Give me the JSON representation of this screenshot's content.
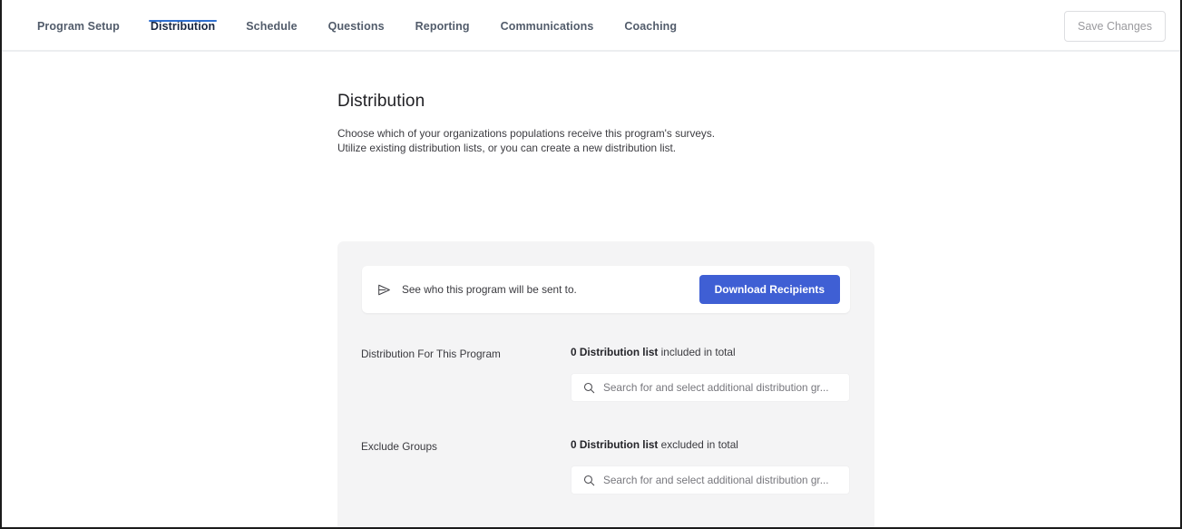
{
  "nav": {
    "tabs": [
      {
        "label": "Program Setup",
        "active": false
      },
      {
        "label": "Distribution",
        "active": true
      },
      {
        "label": "Schedule",
        "active": false
      },
      {
        "label": "Questions",
        "active": false
      },
      {
        "label": "Reporting",
        "active": false
      },
      {
        "label": "Communications",
        "active": false
      },
      {
        "label": "Coaching",
        "active": false
      }
    ],
    "save_label": "Save Changes"
  },
  "main": {
    "title": "Distribution",
    "description_line_1": "Choose which of your organizations populations receive this program's surveys.",
    "description_line_2": "Utilize existing distribution lists, or you can create a new distribution list."
  },
  "recipients_card": {
    "icon": "send-icon",
    "text": "See who this program will be sent to.",
    "button_label": "Download Recipients"
  },
  "distribution_row": {
    "label": "Distribution For This Program",
    "count_strong": "0 Distribution list",
    "count_rest": " included in total",
    "search_placeholder": "Search for and select additional distribution gr...",
    "search_value": "",
    "search_icon": "search-icon"
  },
  "exclude_row": {
    "label": "Exclude Groups",
    "count_strong": "0 Distribution list",
    "count_rest": " excluded in total",
    "search_placeholder": "Search for and select additional distribution gr...",
    "search_value": "",
    "search_icon": "search-icon"
  },
  "colors": {
    "accent_blue": "#3f5fd4",
    "tab_underline": "#2f6fd0",
    "panel_grey": "#f4f4f5",
    "active_tab_text": "#1a2740",
    "inactive_tab_text": "#525c6b"
  }
}
